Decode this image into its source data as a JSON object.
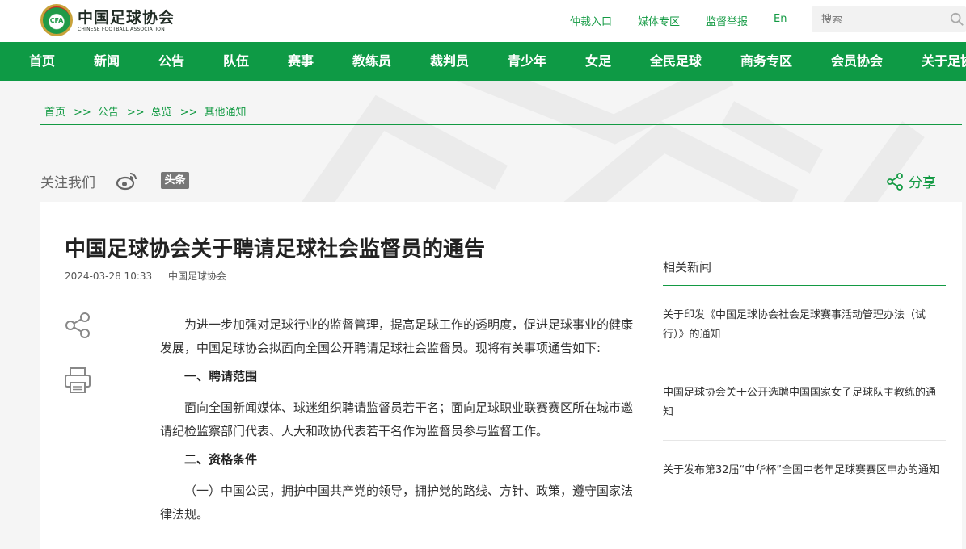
{
  "header": {
    "logo_cn": "中国足球协会",
    "logo_en": "CHINESE FOOTBALL ASSOCIATION",
    "logo_badge": "CFA",
    "top_links": [
      "仲裁入口",
      "媒体专区",
      "监督举报",
      "En"
    ],
    "search_placeholder": "搜索"
  },
  "nav": [
    "首页",
    "新闻",
    "公告",
    "队伍",
    "赛事",
    "教练员",
    "裁判员",
    "青少年",
    "女足",
    "全民足球",
    "商务专区",
    "会员协会",
    "关于足协"
  ],
  "breadcrumb": [
    "首页",
    "公告",
    "总览",
    "其他通知"
  ],
  "breadcrumb_sep": ">>",
  "social": {
    "follow_label": "关注我们",
    "toutiao_label": "头条",
    "share_label": "分享"
  },
  "article": {
    "title": "中国足球协会关于聘请足球社会监督员的通告",
    "date": "2024-03-28 10:33",
    "source": "中国足球协会",
    "paragraphs": [
      "为进一步加强对足球行业的监督管理，提高足球工作的透明度，促进足球事业的健康发展，中国足球协会拟面向全国公开聘请足球社会监督员。现将有关事项通告如下:",
      "一、聘请范围",
      "面向全国新闻媒体、球迷组织聘请监督员若干名；面向足球职业联赛赛区所在城市邀请纪检监察部门代表、人大和政协代表若干名作为监督员参与监督工作。",
      "二、资格条件",
      "（一）中国公民，拥护中国共产党的领导，拥护党的路线、方针、政策，遵守国家法律法规。"
    ]
  },
  "related": {
    "title": "相关新闻",
    "items": [
      "关于印发《中国足球协会社会足球赛事活动管理办法（试行）》的通知",
      "中国足球协会关于公开选聘中国国家女子足球队主教练的通知",
      "关于发布第32届“中华杯”全国中老年足球赛赛区申办的通知"
    ]
  },
  "colors": {
    "brand_green": "#0e9a45",
    "link_green": "#139a43"
  }
}
